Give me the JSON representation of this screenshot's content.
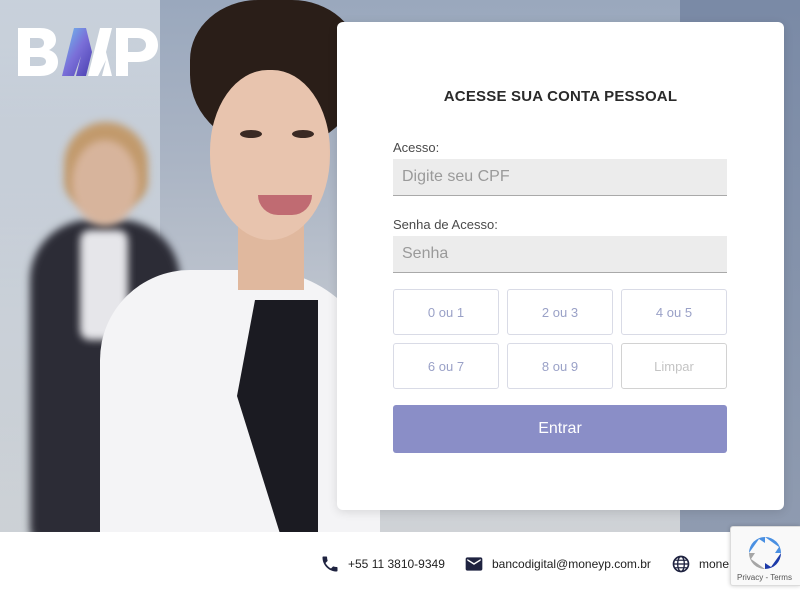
{
  "brand": {
    "logo_text": "BMP",
    "accent": "#8a8ec7"
  },
  "login": {
    "title": "ACESSE SUA CONTA PESSOAL",
    "cpf_label": "Acesso:",
    "cpf_placeholder": "Digite seu CPF",
    "password_label": "Senha de Acesso:",
    "password_placeholder": "Senha",
    "keys": [
      "0 ou 1",
      "2 ou 3",
      "4 ou 5",
      "6 ou 7",
      "8 ou 9",
      "Limpar"
    ],
    "submit_label": "Entrar"
  },
  "footer": {
    "phone": "+55 11 3810-9349",
    "email": "bancodigital@moneyp.com.br",
    "website": "mone"
  },
  "recaptcha": {
    "links": "Privacy - Terms"
  },
  "icons": {
    "phone": "phone-icon",
    "email": "mail-icon",
    "web": "globe-icon",
    "recaptcha": "recaptcha-icon"
  }
}
